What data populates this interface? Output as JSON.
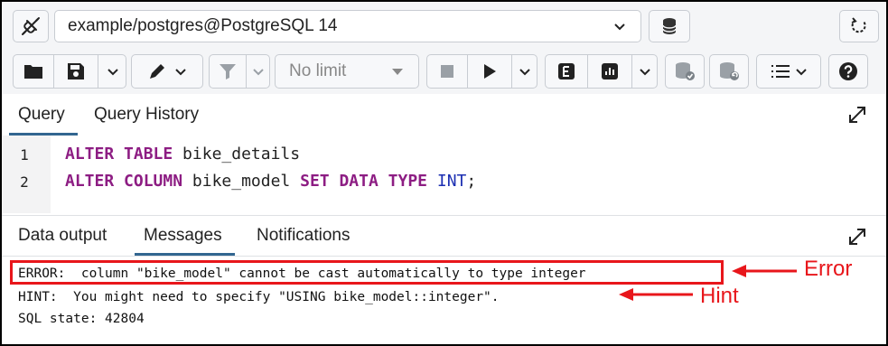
{
  "toolbar": {
    "connection": "example/postgres@PostgreSQL 14",
    "limit_label": "No limit"
  },
  "editor_tabs": [
    "Query",
    "Query History"
  ],
  "editor": {
    "lines": [
      {
        "no": "1",
        "tokens": [
          {
            "t": "ALTER",
            "k": "kw"
          },
          {
            "t": " "
          },
          {
            "t": "TABLE",
            "k": "kw"
          },
          {
            "t": " bike_details"
          }
        ]
      },
      {
        "no": "2",
        "tokens": [
          {
            "t": "ALTER",
            "k": "kw"
          },
          {
            "t": " "
          },
          {
            "t": "COLUMN",
            "k": "kw"
          },
          {
            "t": " bike_model "
          },
          {
            "t": "SET",
            "k": "kw"
          },
          {
            "t": " "
          },
          {
            "t": "DATA",
            "k": "kw"
          },
          {
            "t": " "
          },
          {
            "t": "TYPE",
            "k": "kw"
          },
          {
            "t": " "
          },
          {
            "t": "INT",
            "k": "ty"
          },
          {
            "t": ";"
          }
        ]
      }
    ]
  },
  "output_tabs": [
    "Data output",
    "Messages",
    "Notifications"
  ],
  "messages": [
    "ERROR:  column \"bike_model\" cannot be cast automatically to type integer",
    "HINT:  You might need to specify \"USING bike_model::integer\".",
    "SQL state: 42804"
  ],
  "annotations": {
    "error": "Error",
    "hint": "Hint"
  },
  "colors": {
    "accent": "#326690",
    "keyword": "#8d1d83",
    "type": "#1c2fb2",
    "annotation": "#e8161b"
  }
}
